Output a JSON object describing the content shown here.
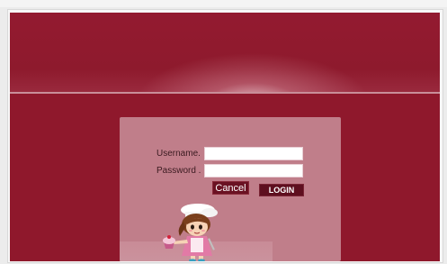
{
  "login": {
    "username_label": "Username.",
    "password_label": "Password .",
    "username_value": "",
    "password_value": "",
    "cancel_label": "Cancel",
    "login_label": "LOGIN"
  },
  "colors": {
    "brand_red": "#8f182c",
    "panel_pink": "#c07e8a",
    "button_dark": "#5e0f1f"
  },
  "icons": {
    "mascot": "chef-girl-mascot-icon"
  }
}
